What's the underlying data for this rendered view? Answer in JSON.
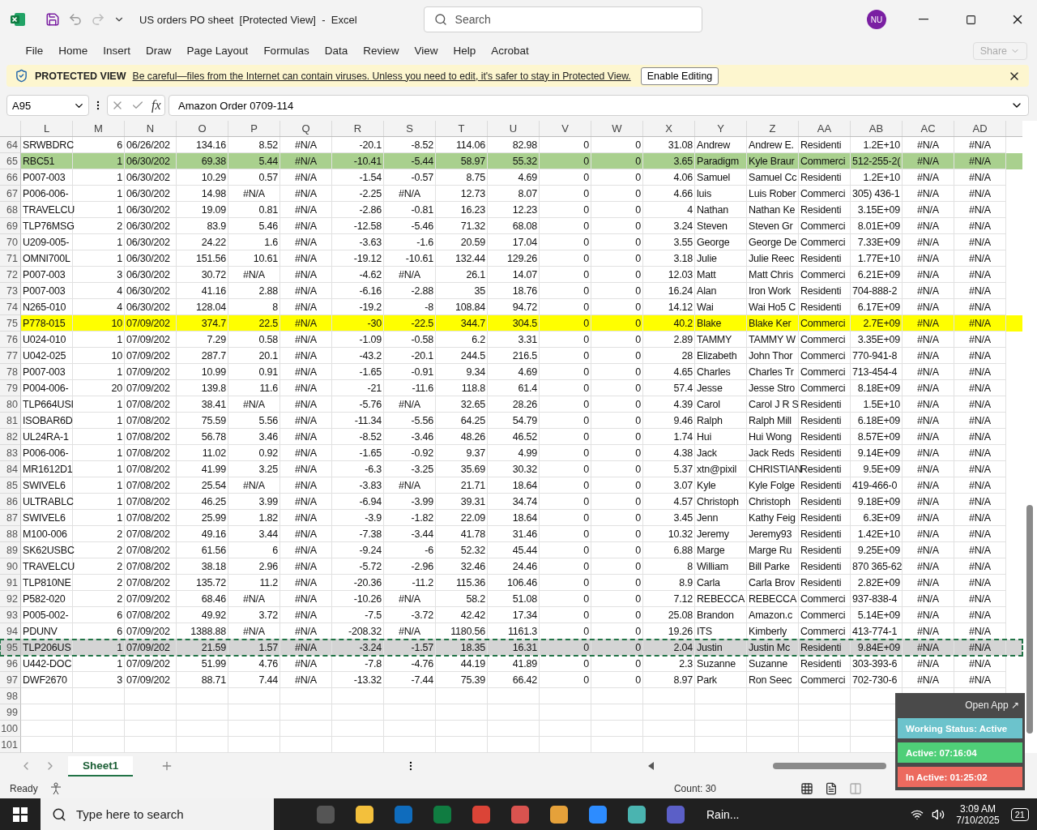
{
  "window": {
    "title": "US orders PO sheet  [Protected View]  -  Excel",
    "search_placeholder": "Search",
    "user_initials": "NU"
  },
  "ribbon_tabs": [
    "File",
    "Home",
    "Insert",
    "Draw",
    "Page Layout",
    "Formulas",
    "Data",
    "Review",
    "View",
    "Help",
    "Acrobat"
  ],
  "share_button": "Share",
  "protected_view": {
    "label": "PROTECTED VIEW",
    "message": "Be careful—files from the Internet can contain viruses. Unless you need to edit, it's safer to stay in Protected View.",
    "button": "Enable Editing"
  },
  "formula_bar": {
    "name_box": "A95",
    "formula": "Amazon Order 0709-114",
    "fx_label": "fx"
  },
  "grid": {
    "columns": [
      "L",
      "M",
      "N",
      "O",
      "P",
      "Q",
      "R",
      "S",
      "T",
      "U",
      "V",
      "W",
      "X",
      "Y",
      "Z",
      "AA",
      "AB",
      "AC",
      "AD"
    ],
    "rows": [
      {
        "header": "64",
        "color": "#ffffff",
        "selected": false,
        "cells": [
          "SRWBDRC",
          "6",
          "06/26/202",
          "134.16",
          "8.52",
          "#N/A",
          "-20.1",
          "-8.52",
          "114.06",
          "82.98",
          "0",
          "0",
          "31.08",
          "Andrew",
          "Andrew E.",
          "Residenti",
          "1.2E+10",
          "#N/A",
          "#N/A"
        ]
      },
      {
        "header": "65",
        "color": "#a9d08e",
        "selected": false,
        "cells": [
          "RBC51",
          "1",
          "06/30/202",
          "69.38",
          "5.44",
          "#N/A",
          "-10.41",
          "-5.44",
          "58.97",
          "55.32",
          "0",
          "0",
          "3.65",
          "Paradigm",
          "Kyle Braur",
          "Commerci",
          "512-255-2(",
          "#N/A",
          "#N/A"
        ]
      },
      {
        "header": "66",
        "color": "#ffffff",
        "selected": false,
        "cells": [
          "P007-003",
          "1",
          "06/30/202",
          "10.29",
          "0.57",
          "#N/A",
          "-1.54",
          "-0.57",
          "8.75",
          "4.69",
          "0",
          "0",
          "4.06",
          "Samuel",
          "Samuel Cc",
          "Residenti",
          "1.2E+10",
          "#N/A",
          "#N/A"
        ]
      },
      {
        "header": "67",
        "color": "#ffffff",
        "selected": false,
        "cells": [
          "P006-006-",
          "1",
          "06/30/202",
          "14.98",
          "#N/A",
          "#N/A",
          "-2.25",
          "#N/A",
          "12.73",
          "8.07",
          "0",
          "0",
          "4.66",
          "luis",
          "Luis Rober",
          "Commerci",
          "305) 436-1",
          "#N/A",
          "#N/A"
        ]
      },
      {
        "header": "68",
        "color": "#ffffff",
        "selected": false,
        "cells": [
          "TRAVELCU",
          "1",
          "06/30/202",
          "19.09",
          "0.81",
          "#N/A",
          "-2.86",
          "-0.81",
          "16.23",
          "12.23",
          "0",
          "0",
          "4",
          "Nathan",
          "Nathan Ke",
          "Residenti",
          "3.15E+09",
          "#N/A",
          "#N/A"
        ]
      },
      {
        "header": "69",
        "color": "#ffffff",
        "selected": false,
        "cells": [
          "TLP76MSG",
          "2",
          "06/30/202",
          "83.9",
          "5.46",
          "#N/A",
          "-12.58",
          "-5.46",
          "71.32",
          "68.08",
          "0",
          "0",
          "3.24",
          "Steven",
          "Steven Gr",
          "Commerci",
          "8.01E+09",
          "#N/A",
          "#N/A"
        ]
      },
      {
        "header": "70",
        "color": "#ffffff",
        "selected": false,
        "cells": [
          "U209-005-",
          "1",
          "06/30/202",
          "24.22",
          "1.6",
          "#N/A",
          "-3.63",
          "-1.6",
          "20.59",
          "17.04",
          "0",
          "0",
          "3.55",
          "George",
          "George De",
          "Commerci",
          "7.33E+09",
          "#N/A",
          "#N/A"
        ]
      },
      {
        "header": "71",
        "color": "#ffffff",
        "selected": false,
        "cells": [
          "OMNI700L",
          "1",
          "06/30/202",
          "151.56",
          "10.61",
          "#N/A",
          "-19.12",
          "-10.61",
          "132.44",
          "129.26",
          "0",
          "0",
          "3.18",
          "Julie",
          "Julie Reec",
          "Residenti",
          "1.77E+10",
          "#N/A",
          "#N/A"
        ]
      },
      {
        "header": "72",
        "color": "#ffffff",
        "selected": false,
        "cells": [
          "P007-003",
          "3",
          "06/30/202",
          "30.72",
          "#N/A",
          "#N/A",
          "-4.62",
          "#N/A",
          "26.1",
          "14.07",
          "0",
          "0",
          "12.03",
          "Matt",
          "Matt Chris",
          "Commerci",
          "6.21E+09",
          "#N/A",
          "#N/A"
        ]
      },
      {
        "header": "73",
        "color": "#ffffff",
        "selected": false,
        "cells": [
          "P007-003",
          "4",
          "06/30/202",
          "41.16",
          "2.88",
          "#N/A",
          "-6.16",
          "-2.88",
          "35",
          "18.76",
          "0",
          "0",
          "16.24",
          "Alan",
          "Iron Work",
          "Residenti",
          "704-888-2",
          "#N/A",
          "#N/A"
        ]
      },
      {
        "header": "74",
        "color": "#ffffff",
        "selected": false,
        "cells": [
          "N265-010",
          "4",
          "06/30/202",
          "128.04",
          "8",
          "#N/A",
          "-19.2",
          "-8",
          "108.84",
          "94.72",
          "0",
          "0",
          "14.12",
          "Wai",
          "Wai Ho5 C",
          "Residenti",
          "6.17E+09",
          "#N/A",
          "#N/A"
        ]
      },
      {
        "header": "75",
        "color": "#ffff00",
        "selected": false,
        "cells": [
          "P778-015",
          "10",
          "07/09/202",
          "374.7",
          "22.5",
          "#N/A",
          "-30",
          "-22.5",
          "344.7",
          "304.5",
          "0",
          "0",
          "40.2",
          "Blake",
          "Blake Ker",
          "Commerci",
          "2.7E+09",
          "#N/A",
          "#N/A"
        ]
      },
      {
        "header": "76",
        "color": "#ffffff",
        "selected": false,
        "cells": [
          "U024-010",
          "1",
          "07/09/202",
          "7.29",
          "0.58",
          "#N/A",
          "-1.09",
          "-0.58",
          "6.2",
          "3.31",
          "0",
          "0",
          "2.89",
          "TAMMY",
          "TAMMY W",
          "Commerci",
          "3.35E+09",
          "#N/A",
          "#N/A"
        ]
      },
      {
        "header": "77",
        "color": "#ffffff",
        "selected": false,
        "cells": [
          "U042-025",
          "10",
          "07/09/202",
          "287.7",
          "20.1",
          "#N/A",
          "-43.2",
          "-20.1",
          "244.5",
          "216.5",
          "0",
          "0",
          "28",
          "Elizabeth",
          "John Thor",
          "Commerci",
          "770-941-8",
          "#N/A",
          "#N/A"
        ]
      },
      {
        "header": "78",
        "color": "#ffffff",
        "selected": false,
        "cells": [
          "P007-003",
          "1",
          "07/09/202",
          "10.99",
          "0.91",
          "#N/A",
          "-1.65",
          "-0.91",
          "9.34",
          "4.69",
          "0",
          "0",
          "4.65",
          "Charles",
          "Charles Tr",
          "Commerci",
          "713-454-4",
          "#N/A",
          "#N/A"
        ]
      },
      {
        "header": "79",
        "color": "#ffffff",
        "selected": false,
        "cells": [
          "P004-006-",
          "20",
          "07/09/202",
          "139.8",
          "11.6",
          "#N/A",
          "-21",
          "-11.6",
          "118.8",
          "61.4",
          "0",
          "0",
          "57.4",
          "Jesse",
          "Jesse Stro",
          "Commerci",
          "8.18E+09",
          "#N/A",
          "#N/A"
        ]
      },
      {
        "header": "80",
        "color": "#ffffff",
        "selected": false,
        "cells": [
          "TLP664USI",
          "1",
          "07/08/202",
          "38.41",
          "#N/A",
          "#N/A",
          "-5.76",
          "#N/A",
          "32.65",
          "28.26",
          "0",
          "0",
          "4.39",
          "Carol",
          "Carol J R S",
          "Residenti",
          "1.5E+10",
          "#N/A",
          "#N/A"
        ]
      },
      {
        "header": "81",
        "color": "#ffffff",
        "selected": false,
        "cells": [
          "ISOBAR6D",
          "1",
          "07/08/202",
          "75.59",
          "5.56",
          "#N/A",
          "-11.34",
          "-5.56",
          "64.25",
          "54.79",
          "0",
          "0",
          "9.46",
          "Ralph",
          "Ralph Mill",
          "Residenti",
          "6.18E+09",
          "#N/A",
          "#N/A"
        ]
      },
      {
        "header": "82",
        "color": "#ffffff",
        "selected": false,
        "cells": [
          "UL24RA-1",
          "1",
          "07/08/202",
          "56.78",
          "3.46",
          "#N/A",
          "-8.52",
          "-3.46",
          "48.26",
          "46.52",
          "0",
          "0",
          "1.74",
          "Hui",
          "Hui Wong",
          "Residenti",
          "8.57E+09",
          "#N/A",
          "#N/A"
        ]
      },
      {
        "header": "83",
        "color": "#ffffff",
        "selected": false,
        "cells": [
          "P006-006-",
          "1",
          "07/08/202",
          "11.02",
          "0.92",
          "#N/A",
          "-1.65",
          "-0.92",
          "9.37",
          "4.99",
          "0",
          "0",
          "4.38",
          "Jack",
          "Jack Reds",
          "Residenti",
          "9.14E+09",
          "#N/A",
          "#N/A"
        ]
      },
      {
        "header": "84",
        "color": "#ffffff",
        "selected": false,
        "cells": [
          "MR1612D1",
          "1",
          "07/08/202",
          "41.99",
          "3.25",
          "#N/A",
          "-6.3",
          "-3.25",
          "35.69",
          "30.32",
          "0",
          "0",
          "5.37",
          "xtn@pixil",
          "CHRISTIAN",
          "Residenti",
          "9.5E+09",
          "#N/A",
          "#N/A"
        ]
      },
      {
        "header": "85",
        "color": "#ffffff",
        "selected": false,
        "cells": [
          "SWIVEL6",
          "1",
          "07/08/202",
          "25.54",
          "#N/A",
          "#N/A",
          "-3.83",
          "#N/A",
          "21.71",
          "18.64",
          "0",
          "0",
          "3.07",
          "Kyle",
          "Kyle Folge",
          "Residenti",
          "419-466-0",
          "#N/A",
          "#N/A"
        ]
      },
      {
        "header": "86",
        "color": "#ffffff",
        "selected": false,
        "cells": [
          "ULTRABLC",
          "1",
          "07/08/202",
          "46.25",
          "3.99",
          "#N/A",
          "-6.94",
          "-3.99",
          "39.31",
          "34.74",
          "0",
          "0",
          "4.57",
          "Christoph",
          "Christoph",
          "Residenti",
          "9.18E+09",
          "#N/A",
          "#N/A"
        ]
      },
      {
        "header": "87",
        "color": "#ffffff",
        "selected": false,
        "cells": [
          "SWIVEL6",
          "1",
          "07/08/202",
          "25.99",
          "1.82",
          "#N/A",
          "-3.9",
          "-1.82",
          "22.09",
          "18.64",
          "0",
          "0",
          "3.45",
          "Jenn",
          "Kathy Feig",
          "Residenti",
          "6.3E+09",
          "#N/A",
          "#N/A"
        ]
      },
      {
        "header": "88",
        "color": "#ffffff",
        "selected": false,
        "cells": [
          "M100-006",
          "2",
          "07/08/202",
          "49.16",
          "3.44",
          "#N/A",
          "-7.38",
          "-3.44",
          "41.78",
          "31.46",
          "0",
          "0",
          "10.32",
          "Jeremy",
          "Jeremy93",
          "Residenti",
          "1.42E+10",
          "#N/A",
          "#N/A"
        ]
      },
      {
        "header": "89",
        "color": "#ffffff",
        "selected": false,
        "cells": [
          "SK62USBC",
          "2",
          "07/08/202",
          "61.56",
          "6",
          "#N/A",
          "-9.24",
          "-6",
          "52.32",
          "45.44",
          "0",
          "0",
          "6.88",
          "Marge",
          "Marge Ru",
          "Residenti",
          "9.25E+09",
          "#N/A",
          "#N/A"
        ]
      },
      {
        "header": "90",
        "color": "#ffffff",
        "selected": false,
        "cells": [
          "TRAVELCU",
          "2",
          "07/08/202",
          "38.18",
          "2.96",
          "#N/A",
          "-5.72",
          "-2.96",
          "32.46",
          "24.46",
          "0",
          "0",
          "8",
          "William",
          "Bill Parke",
          "Residenti",
          "870 365-62",
          "#N/A",
          "#N/A"
        ]
      },
      {
        "header": "91",
        "color": "#ffffff",
        "selected": false,
        "cells": [
          "TLP810NE",
          "2",
          "07/08/202",
          "135.72",
          "11.2",
          "#N/A",
          "-20.36",
          "-11.2",
          "115.36",
          "106.46",
          "0",
          "0",
          "8.9",
          "Carla",
          "Carla Brov",
          "Residenti",
          "2.82E+09",
          "#N/A",
          "#N/A"
        ]
      },
      {
        "header": "92",
        "color": "#ffffff",
        "selected": false,
        "cells": [
          "P582-020",
          "2",
          "07/09/202",
          "68.46",
          "#N/A",
          "#N/A",
          "-10.26",
          "#N/A",
          "58.2",
          "51.08",
          "0",
          "0",
          "7.12",
          "REBECCA",
          "REBECCA",
          "Commerci",
          "937-838-4",
          "#N/A",
          "#N/A"
        ]
      },
      {
        "header": "93",
        "color": "#ffffff",
        "selected": false,
        "cells": [
          "P005-002-",
          "6",
          "07/08/202",
          "49.92",
          "3.72",
          "#N/A",
          "-7.5",
          "-3.72",
          "42.42",
          "17.34",
          "0",
          "0",
          "25.08",
          "Brandon",
          "Amazon.c",
          "Commerci",
          "5.14E+09",
          "#N/A",
          "#N/A"
        ]
      },
      {
        "header": "94",
        "color": "#ffffff",
        "selected": false,
        "cells": [
          "PDUNV",
          "6",
          "07/09/202",
          "1388.88",
          "#N/A",
          "#N/A",
          "-208.32",
          "#N/A",
          "1180.56",
          "1161.3",
          "0",
          "0",
          "19.26",
          "ITS",
          "Kimberly",
          "Commerci",
          "413-774-1",
          "#N/A",
          "#N/A"
        ]
      },
      {
        "header": "95",
        "color": "#ffffff",
        "selected": true,
        "cells": [
          "TLP206US",
          "1",
          "07/09/202",
          "21.59",
          "1.57",
          "#N/A",
          "-3.24",
          "-1.57",
          "18.35",
          "16.31",
          "0",
          "0",
          "2.04",
          "Justin",
          "Justin Mc",
          "Residenti",
          "9.84E+09",
          "#N/A",
          "#N/A"
        ]
      },
      {
        "header": "96",
        "color": "#ffffff",
        "selected": false,
        "cells": [
          "U442-DOC",
          "1",
          "07/09/202",
          "51.99",
          "4.76",
          "#N/A",
          "-7.8",
          "-4.76",
          "44.19",
          "41.89",
          "0",
          "0",
          "2.3",
          "Suzanne",
          "Suzanne",
          "Residenti",
          "303-393-6",
          "#N/A",
          "#N/A"
        ]
      },
      {
        "header": "97",
        "color": "#ffffff",
        "selected": false,
        "cells": [
          "DWF2670",
          "3",
          "07/09/202",
          "88.71",
          "7.44",
          "#N/A",
          "-13.32",
          "-7.44",
          "75.39",
          "66.42",
          "0",
          "0",
          "8.97",
          "Park",
          "Ron Seec",
          "Commerci",
          "702-730-6",
          "#N/A",
          "#N/A"
        ]
      }
    ],
    "empty_rows": [
      "98",
      "99",
      "100",
      "101"
    ]
  },
  "sheet_tabs": [
    {
      "label": "Sheet1",
      "selected": true
    }
  ],
  "status_bar": {
    "mode": "Ready",
    "count": "Count: 30"
  },
  "widget": {
    "open_app": "Open App ↗",
    "items": [
      {
        "label": "Working Status: Active",
        "color": "#6cc3cc"
      },
      {
        "label": "Active: 07:16:04",
        "color": "#4fcf78"
      },
      {
        "label": "In Active: 01:25:02",
        "color": "#ec6a5f"
      }
    ]
  },
  "taskbar": {
    "search_placeholder": "Type here to search",
    "weather": "Rain...",
    "time": "3:09 AM",
    "date": "7/10/2025",
    "notifications": "21"
  }
}
